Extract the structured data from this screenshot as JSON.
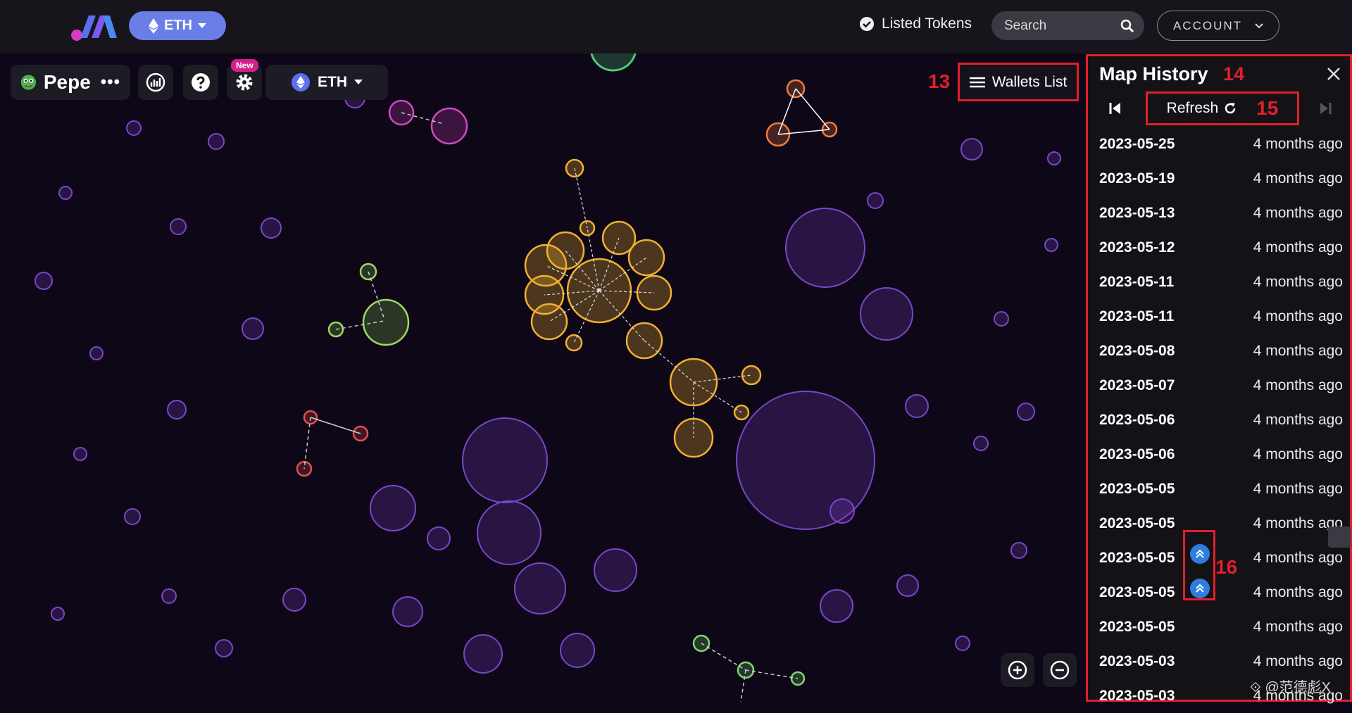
{
  "topbar": {
    "chain_label": "ETH",
    "listed_tokens_label": "Listed Tokens",
    "search_placeholder": "Search",
    "account_label": "ACCOUNT"
  },
  "map_toolbar": {
    "token_name": "Pepe",
    "more_label": "•••",
    "new_badge": "New",
    "chain_label": "ETH",
    "wallets_list_label": "Wallets List"
  },
  "annotations": {
    "wallets": "13",
    "history": "14",
    "refresh": "15",
    "badges": "16"
  },
  "history": {
    "title": "Map History",
    "refresh_label": "Refresh",
    "items": [
      {
        "date": "2023-05-25",
        "ago": "4 months ago"
      },
      {
        "date": "2023-05-19",
        "ago": "4 months ago"
      },
      {
        "date": "2023-05-13",
        "ago": "4 months ago"
      },
      {
        "date": "2023-05-12",
        "ago": "4 months ago"
      },
      {
        "date": "2023-05-11",
        "ago": "4 months ago"
      },
      {
        "date": "2023-05-11",
        "ago": "4 months ago"
      },
      {
        "date": "2023-05-08",
        "ago": "4 months ago"
      },
      {
        "date": "2023-05-07",
        "ago": "4 months ago"
      },
      {
        "date": "2023-05-06",
        "ago": "4 months ago"
      },
      {
        "date": "2023-05-06",
        "ago": "4 months ago"
      },
      {
        "date": "2023-05-05",
        "ago": "4 months ago"
      },
      {
        "date": "2023-05-05",
        "ago": "4 months ago"
      },
      {
        "date": "2023-05-05",
        "ago": "4 months ago"
      },
      {
        "date": "2023-05-05",
        "ago": "4 months ago"
      },
      {
        "date": "2023-05-05",
        "ago": "4 months ago"
      },
      {
        "date": "2023-05-03",
        "ago": "4 months ago"
      },
      {
        "date": "2023-05-03",
        "ago": "4 months ago"
      }
    ]
  },
  "watermark": "⟐ @范德彪X",
  "colors": {
    "accent_blue": "#6a7ee8",
    "highlight_red": "#e0202a",
    "bubble_purple": "#7a40c8",
    "bubble_orange": "#f0b030",
    "bubble_green": "#9ad86a",
    "bubble_red": "#e05050"
  }
}
